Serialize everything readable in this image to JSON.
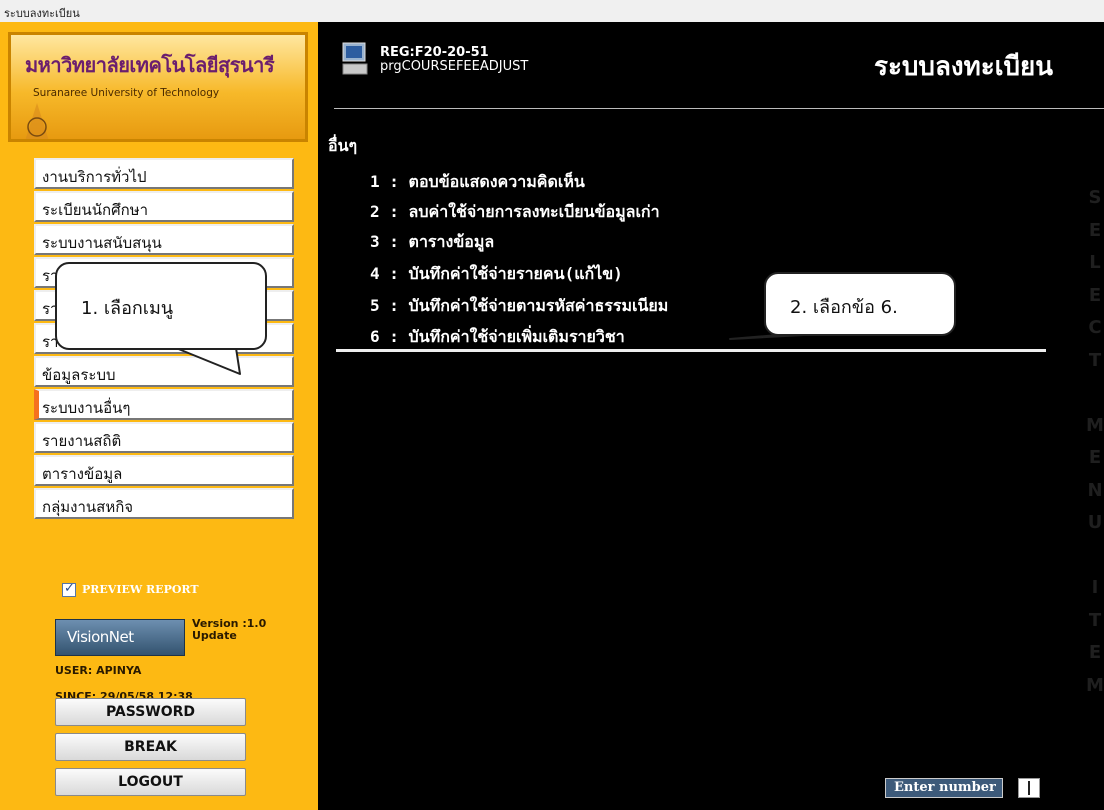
{
  "window": {
    "title": "ระบบลงทะเบียน"
  },
  "sidebar": {
    "logo": {
      "th": "มหาวิทยาลัยเทคโนโลยีสุรนารี",
      "en": "Suranaree University of Technology"
    },
    "menu": [
      {
        "label": "งานบริการทั่วไป"
      },
      {
        "label": "ระเบียนนักศึกษา"
      },
      {
        "label": "ระบบงานสนับสนุน"
      },
      {
        "label": "รายงานผล"
      },
      {
        "label": "รา"
      },
      {
        "label": "รา"
      },
      {
        "label": "ข้อมูลระบบ"
      },
      {
        "label": "ระบบงานอื่นๆ",
        "active": true
      },
      {
        "label": "รายงานสถิติ"
      },
      {
        "label": "ตารางข้อมูล"
      },
      {
        "label": "กลุ่มงานสหกิจ"
      }
    ],
    "preview": {
      "checked": true,
      "check_glyph": "✓",
      "label": "PREVIEW REPORT"
    },
    "brand": {
      "logo_text": "VisionNet",
      "version": "Version :1.0",
      "update": "Update"
    },
    "user": "USER: APINYA",
    "since": "SINCE: 29/05/58 12:38",
    "buttons": {
      "password": "PASSWORD",
      "break": "BREAK",
      "logout": "LOGOUT"
    }
  },
  "main": {
    "form_code": "REG:F20-20-51",
    "program": "prgCOURSEFEEADJUST",
    "title": "ระบบลงทะเบียน",
    "section": "อื่นๆ",
    "options": [
      {
        "num": "1 :",
        "label": "ตอบข้อแสดงความคิดเห็น"
      },
      {
        "num": "2 :",
        "label": "ลบค่าใช้จ่ายการลงทะเบียนข้อมูลเก่า"
      },
      {
        "num": "3 :",
        "label": "ตารางข้อมูล"
      },
      {
        "num": "4 :",
        "label": "บันทึกค่าใช้จ่ายรายคน(แก้ไข)"
      },
      {
        "num": "5 :",
        "label": "บันทึกค่าใช้จ่ายตามรหัสค่าธรรมเนียม"
      },
      {
        "num": "6 :",
        "label": "บันทึกค่าใช้จ่ายเพิ่มเติมรายวิชา"
      }
    ],
    "vertical_label": [
      "S",
      "E",
      "L",
      "E",
      "C",
      "T",
      "",
      "M",
      "E",
      "N",
      "U",
      "",
      "I",
      "T",
      "E",
      "M"
    ],
    "enter_label": "Enter number"
  },
  "annotations": {
    "callout1": "1. เลือกเมนู",
    "callout2": "2. เลือกข้อ 6."
  },
  "colors": {
    "sidebar": "#fdb913",
    "main_bg": "#000000",
    "active_marker": "#f5711f",
    "enter_bg": "#3d5a7a"
  }
}
